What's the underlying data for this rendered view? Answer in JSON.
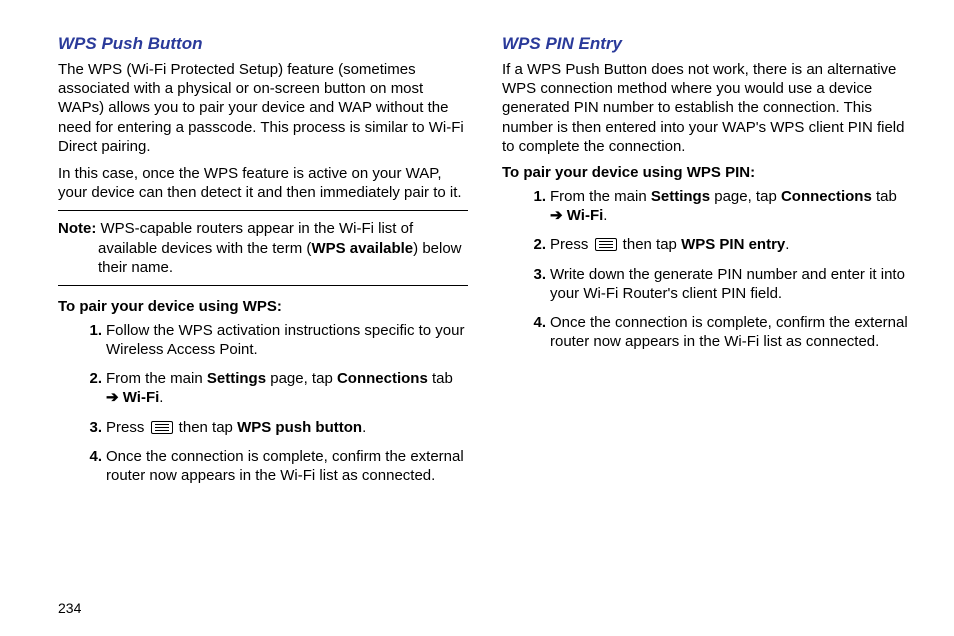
{
  "left": {
    "heading": "WPS Push Button",
    "para1": "The WPS (Wi-Fi Protected Setup) feature (sometimes associated with a physical or on-screen button on most WAPs) allows you to pair your device and WAP without the need for entering a passcode. This process is similar to Wi-Fi Direct pairing.",
    "para2": "In this case, once the WPS feature is active on your WAP, your device can then detect it and then immediately pair to it.",
    "note_label": "Note:",
    "note_a": " WPS-capable routers appear in the Wi-Fi list of available devices with the term (",
    "note_bold": "WPS available",
    "note_b": ") below their name.",
    "instr_heading": "To pair your device using WPS:",
    "step1": "Follow the WPS activation instructions specific to your Wireless Access Point.",
    "step2": {
      "a": "From the main ",
      "settings": "Settings",
      "b": " page, tap ",
      "connections": "Connections",
      "c": " tab ",
      "arrow": "➔",
      "wifi": "Wi-Fi",
      "d": "."
    },
    "step3": {
      "a": "Press ",
      "b": " then tap ",
      "bold": "WPS push button",
      "c": "."
    },
    "step4": "Once the connection is complete, confirm the external router now appears in the Wi-Fi list as connected."
  },
  "right": {
    "heading": "WPS PIN Entry",
    "para1": "If a WPS Push Button does not work, there is an alternative WPS connection method where you would use a device generated PIN number to establish the connection. This number is then entered into your WAP's WPS client PIN field to complete the connection.",
    "instr_heading": "To pair your device using WPS PIN:",
    "step1": {
      "a": "From the main ",
      "settings": "Settings",
      "b": " page, tap ",
      "connections": "Connections",
      "c": " tab ",
      "arrow": "➔",
      "wifi": "Wi-Fi",
      "d": "."
    },
    "step2": {
      "a": "Press ",
      "b": "  then tap ",
      "bold": "WPS PIN entry",
      "c": "."
    },
    "step3": "Write down the generate PIN number and enter it into your Wi-Fi Router's client PIN field.",
    "step4": "Once the connection is complete, confirm the external router now appears in the Wi-Fi list as connected."
  },
  "page_number": "234"
}
